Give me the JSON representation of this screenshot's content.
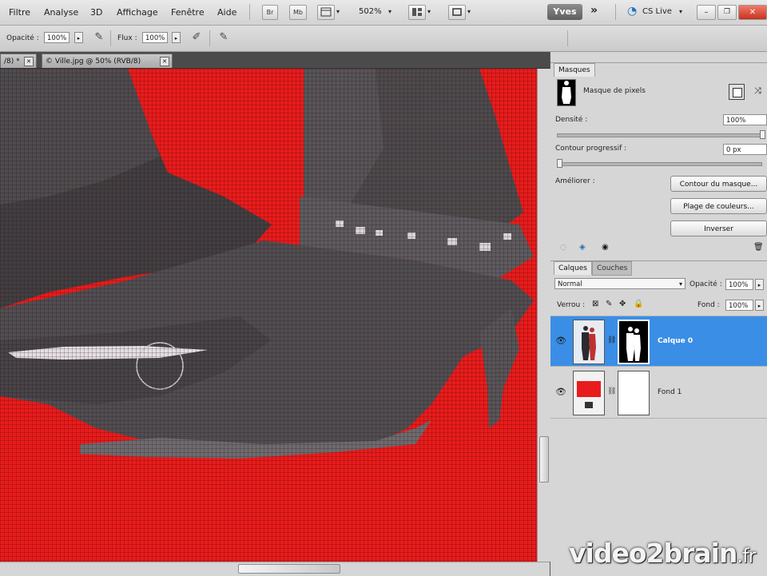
{
  "menubar": {
    "items": [
      "Filtre",
      "Analyse",
      "3D",
      "Affichage",
      "Fenêtre",
      "Aide"
    ],
    "bridge_label": "Br",
    "minibridge_label": "Mb",
    "zoom": "502%",
    "workspace": "Yves",
    "cslive": "CS Live"
  },
  "options": {
    "opacity_label": "Opacité :",
    "opacity_value": "100%",
    "flow_label": "Flux :",
    "flow_value": "100%"
  },
  "tabs": [
    {
      "label": "/8) *"
    },
    {
      "label": "© Ville.jpg @ 50% (RVB/8)"
    }
  ],
  "masks_panel": {
    "tab": "Masques",
    "pixel_mask_label": "Masque de pixels",
    "density_label": "Densité :",
    "density_value": "100%",
    "feather_label": "Contour progressif :",
    "feather_value": "0 px",
    "refine_label": "Améliorer :",
    "btn_mask_edge": "Contour du masque...",
    "btn_color_range": "Plage de couleurs...",
    "btn_invert": "Inverser"
  },
  "layers_panel": {
    "tabs": [
      "Calques",
      "Couches"
    ],
    "blend_mode": "Normal",
    "opacity_label": "Opacité :",
    "opacity_value": "100%",
    "lock_label": "Verrou :",
    "fill_label": "Fond :",
    "fill_value": "100%",
    "layers": [
      {
        "name": "Calque 0",
        "selected": true
      },
      {
        "name": "Fond 1",
        "selected": false
      }
    ]
  },
  "watermark": {
    "brand": "video2brain",
    "tld": ".fr"
  },
  "colors": {
    "canvas_bg": "#e81c1c",
    "selection": "#3a8ee6",
    "boot": "#4a4b4e"
  }
}
